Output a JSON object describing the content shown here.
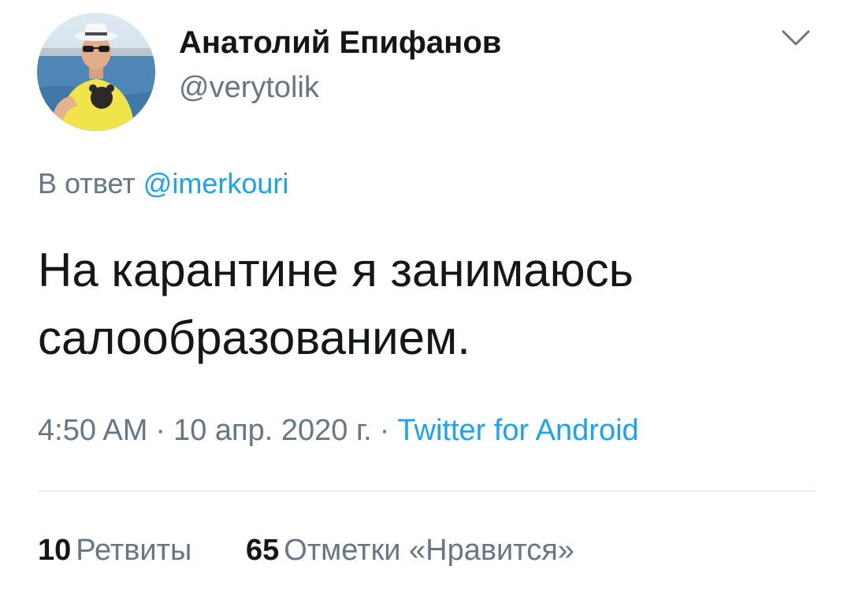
{
  "tweet": {
    "author": {
      "display_name": "Анатолий Епифанов",
      "handle": "@verytolik"
    },
    "reply": {
      "prefix": "В ответ",
      "mention": "@imerkouri"
    },
    "text": "На карантине я занимаюсь салообразованием.",
    "time": "4:50 AM",
    "date": "10 апр. 2020 г.",
    "separator": "·",
    "source": "Twitter for Android",
    "stats": {
      "retweets_count": "10",
      "retweets_label": "Ретвиты",
      "likes_count": "65",
      "likes_label": "Отметки «Нравится»"
    },
    "icons": {
      "menu": "chevron-down-icon"
    }
  },
  "colors": {
    "text_primary": "#14171a",
    "text_secondary": "#657786",
    "link": "#1da1f2",
    "divider": "#e6ecf0"
  }
}
